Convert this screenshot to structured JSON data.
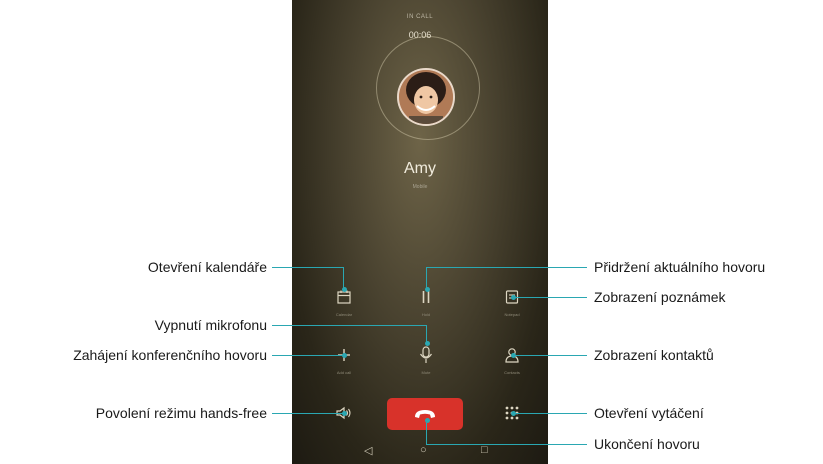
{
  "phone": {
    "status_text": "IN CALL",
    "timer": "00:06",
    "caller_name": "Amy",
    "caller_sub": "Mobile"
  },
  "buttons": {
    "calendar": "Calendar",
    "hold": "Hold",
    "notepad": "Notepad",
    "mute": "Mute",
    "add_call": "Add call",
    "contacts": "Contacts"
  },
  "colors": {
    "accent": "#2aa7b2",
    "end_call": "#d8322a"
  },
  "annotations": {
    "left": {
      "calendar": "Otevření kalendáře",
      "mute": "Vypnutí mikrofonu",
      "conference": "Zahájení konferenčního hovoru",
      "handsfree": "Povolení režimu hands-free"
    },
    "right": {
      "hold": "Přidržení aktuálního hovoru",
      "notes": "Zobrazení poznámek",
      "contacts": "Zobrazení kontaktů",
      "dialpad": "Otevření vytáčení",
      "end_call": "Ukončení hovoru"
    }
  }
}
